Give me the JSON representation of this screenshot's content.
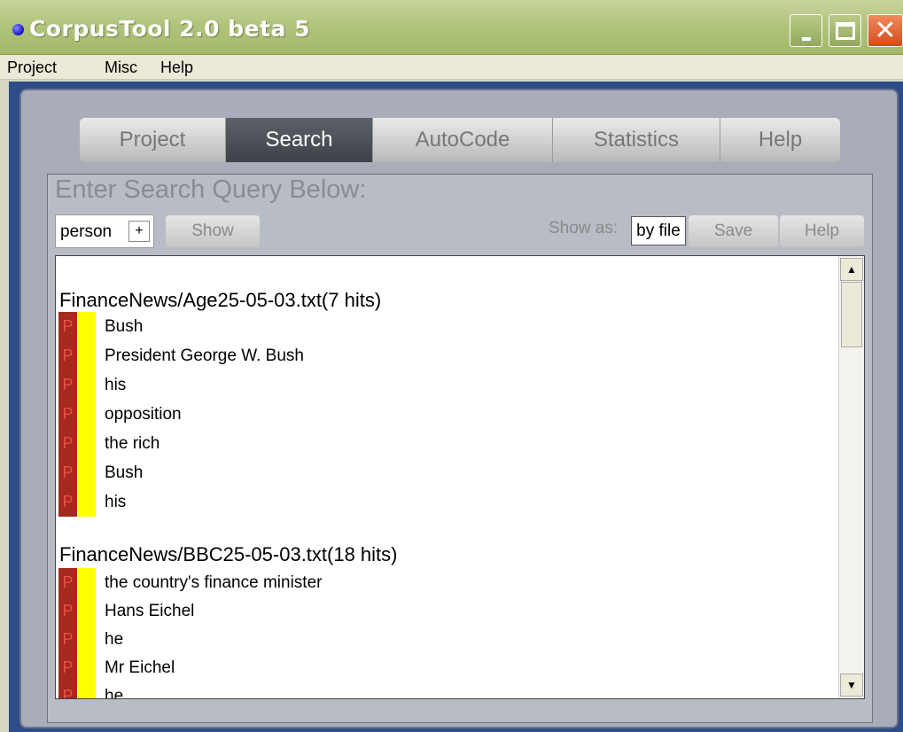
{
  "window": {
    "title": "CorpusTool 2.0 beta 5",
    "controls": [
      "minimize",
      "maximize",
      "close"
    ],
    "close_glyph": "✕"
  },
  "menu": [
    "Project",
    "Misc",
    "Help"
  ],
  "tabs": [
    {
      "label": "Project",
      "active": false
    },
    {
      "label": "Search",
      "active": true
    },
    {
      "label": "AutoCode",
      "active": false
    },
    {
      "label": "Statistics",
      "active": false
    },
    {
      "label": "Help",
      "active": false
    }
  ],
  "search": {
    "heading": "Enter Search Query Below:",
    "query": "person",
    "add_label": "+",
    "show_button": "Show",
    "show_as_label": "Show as:",
    "show_as_value": "by file",
    "save_button": "Save",
    "help_button": "Help"
  },
  "results": [
    {
      "file": "FinanceNews/Age25-05-03.txt(7 hits)",
      "hits": [
        "Bush",
        "President George W. Bush",
        "his",
        "opposition",
        "the rich",
        "Bush",
        "his"
      ]
    },
    {
      "file": "FinanceNews/BBC25-05-03.txt(18 hits)",
      "hits": [
        "the country's finance minister",
        "Hans Eichel",
        "he",
        "Mr Eichel",
        "he"
      ]
    }
  ],
  "hit_marker": "P",
  "colors": {
    "title_bar": "#b1c47c",
    "active_tab": "#4a4e55",
    "marker_red": "#a42a20",
    "marker_yellow": "#ffff00",
    "workspace_border": "#2c4c8a"
  }
}
